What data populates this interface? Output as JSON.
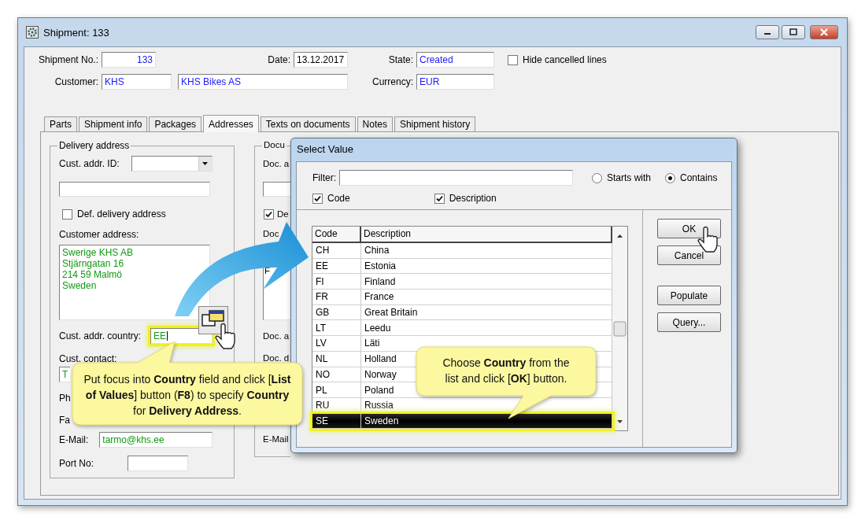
{
  "window": {
    "title": "Shipment: 133"
  },
  "header": {
    "shipment_no": {
      "label": "Shipment No.:",
      "value": "133"
    },
    "date": {
      "label": "Date:",
      "value": "13.12.2017"
    },
    "state": {
      "label": "State:",
      "value": "Created"
    },
    "hide_cancelled": {
      "label": "Hide cancelled lines",
      "checked": false
    },
    "customer": {
      "label": "Customer:",
      "code": "KHS",
      "name": "KHS Bikes AS"
    },
    "currency": {
      "label": "Currency:",
      "value": "EUR"
    }
  },
  "tabs": [
    {
      "label": "Parts",
      "selected": false
    },
    {
      "label": "Shipment info",
      "selected": false
    },
    {
      "label": "Packages",
      "selected": false
    },
    {
      "label": "Addresses",
      "selected": true
    },
    {
      "label": "Texts on documents",
      "selected": false
    },
    {
      "label": "Notes",
      "selected": false
    },
    {
      "label": "Shipment history",
      "selected": false
    }
  ],
  "delivery_address": {
    "title": "Delivery address",
    "cust_addr_id_label": "Cust. addr. ID:",
    "def_delivery": {
      "label": "Def. delivery address",
      "checked": false
    },
    "customer_address_label": "Customer address:",
    "customer_address_lines": [
      "Swerige KHS AB",
      "Stjärngatan 16",
      "214 59 Malmö",
      "Sweden"
    ],
    "country_label": "Cust. addr. country:",
    "country_value": "EE",
    "contact_label": "Cust. contact:",
    "contact_value": "T",
    "phone_label": "Ph",
    "fax_label": "Fa",
    "email_label": "E-Mail:",
    "email_value": "tarmo@khs.ee",
    "port_label": "Port No:"
  },
  "document_address": {
    "title": "Docu",
    "label_1": "Doc. a",
    "checkbox": {
      "label": "De",
      "checked": true
    },
    "label_2": "Doc",
    "address_text": "F",
    "label_3": "Doc. a",
    "label_4": "Doc. d",
    "email_label": "E-Mail"
  },
  "dialog": {
    "title": "Select Value",
    "filter_label": "Filter:",
    "match_options": [
      {
        "label": "Starts with",
        "selected": false
      },
      {
        "label": "Contains",
        "selected": true
      }
    ],
    "search_in": [
      {
        "label": "Code",
        "checked": true
      },
      {
        "label": "Description",
        "checked": true
      }
    ],
    "table": {
      "columns": [
        "Code",
        "Description"
      ],
      "rows": [
        {
          "code": "CH",
          "description": "China",
          "selected": false
        },
        {
          "code": "EE",
          "description": "Estonia",
          "selected": false
        },
        {
          "code": "FI",
          "description": "Finland",
          "selected": false
        },
        {
          "code": "FR",
          "description": "France",
          "selected": false
        },
        {
          "code": "GB",
          "description": "Great Britain",
          "selected": false
        },
        {
          "code": "LT",
          "description": "Leedu",
          "selected": false
        },
        {
          "code": "LV",
          "description": "Läti",
          "selected": false
        },
        {
          "code": "NL",
          "description": "Holland",
          "selected": false
        },
        {
          "code": "NO",
          "description": "Norway",
          "selected": false
        },
        {
          "code": "PL",
          "description": "Poland",
          "selected": false
        },
        {
          "code": "RU",
          "description": "Russia",
          "selected": false
        },
        {
          "code": "SE",
          "description": "Sweden",
          "selected": true
        }
      ]
    },
    "buttons": [
      {
        "label": "OK"
      },
      {
        "label": "Cancel"
      },
      {
        "label": "Populate"
      },
      {
        "label": "Query..."
      }
    ]
  },
  "callouts": [
    {
      "text": "Put focus into **Country** field and click [**List of Values**] button (**F8**) to specify **Country** for **Delivery Address**."
    },
    {
      "text": "Choose **Country** from the list and click [**OK**] button."
    }
  ]
}
